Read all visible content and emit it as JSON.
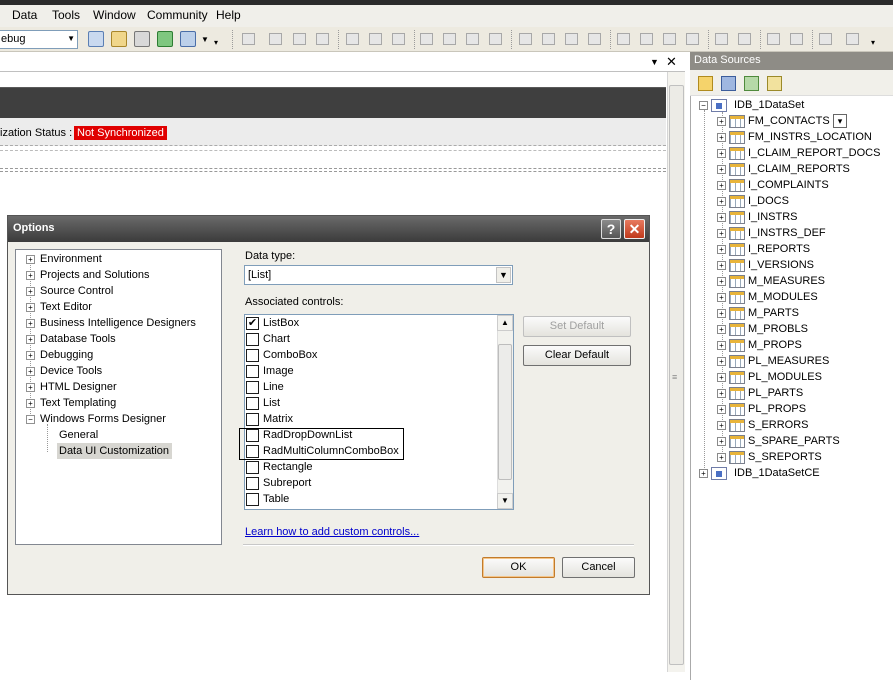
{
  "menubar": {
    "items": [
      "Data",
      "Tools",
      "Window",
      "Community",
      "Help"
    ]
  },
  "toolbar": {
    "config_value": "ebug"
  },
  "document": {
    "status_label": "ization Status :",
    "status_value": "Not Synchronized",
    "status_color": "#e00000"
  },
  "data_sources": {
    "title": "Data Sources",
    "root": "IDB_1DataSet",
    "tables": [
      "FM_CONTACTS",
      "FM_INSTRS_LOCATION",
      "I_CLAIM_REPORT_DOCS",
      "I_CLAIM_REPORTS",
      "I_COMPLAINTS",
      "I_DOCS",
      "I_INSTRS",
      "I_INSTRS_DEF",
      "I_REPORTS",
      "I_VERSIONS",
      "M_MEASURES",
      "M_MODULES",
      "M_PARTS",
      "M_PROBLS",
      "M_PROPS",
      "PL_MEASURES",
      "PL_MODULES",
      "PL_PARTS",
      "PL_PROPS",
      "S_ERRORS",
      "S_SPARE_PARTS",
      "S_SREPORTS"
    ],
    "root2": "IDB_1DataSetCE"
  },
  "dialog": {
    "title": "Options",
    "help_glyph": "?",
    "close_glyph": "✕",
    "nav": [
      {
        "label": "Environment",
        "exp": "+"
      },
      {
        "label": "Projects and Solutions",
        "exp": "+"
      },
      {
        "label": "Source Control",
        "exp": "+"
      },
      {
        "label": "Text Editor",
        "exp": "+"
      },
      {
        "label": "Business Intelligence Designers",
        "exp": "+"
      },
      {
        "label": "Database Tools",
        "exp": "+"
      },
      {
        "label": "Debugging",
        "exp": "+"
      },
      {
        "label": "Device Tools",
        "exp": "+"
      },
      {
        "label": "HTML Designer",
        "exp": "+"
      },
      {
        "label": "Text Templating",
        "exp": "+"
      },
      {
        "label": "Windows Forms Designer",
        "exp": "−"
      }
    ],
    "nav_children": [
      "General",
      "Data UI Customization"
    ],
    "data_type_label": "Data type:",
    "data_type_value": "[List]",
    "assoc_label": "Associated controls:",
    "controls": [
      {
        "label": "ListBox",
        "checked": true
      },
      {
        "label": "Chart",
        "checked": false
      },
      {
        "label": "ComboBox",
        "checked": false
      },
      {
        "label": "Image",
        "checked": false
      },
      {
        "label": "Line",
        "checked": false
      },
      {
        "label": "List",
        "checked": false
      },
      {
        "label": "Matrix",
        "checked": false
      },
      {
        "label": "RadDropDownList",
        "checked": false
      },
      {
        "label": "RadMultiColumnComboBox",
        "checked": false
      },
      {
        "label": "Rectangle",
        "checked": false
      },
      {
        "label": "Subreport",
        "checked": false
      },
      {
        "label": "Table",
        "checked": false
      }
    ],
    "set_default_label": "Set Default",
    "clear_default_label": "Clear Default",
    "learn_link": "Learn how to add custom controls...",
    "ok_label": "OK",
    "cancel_label": "Cancel"
  }
}
